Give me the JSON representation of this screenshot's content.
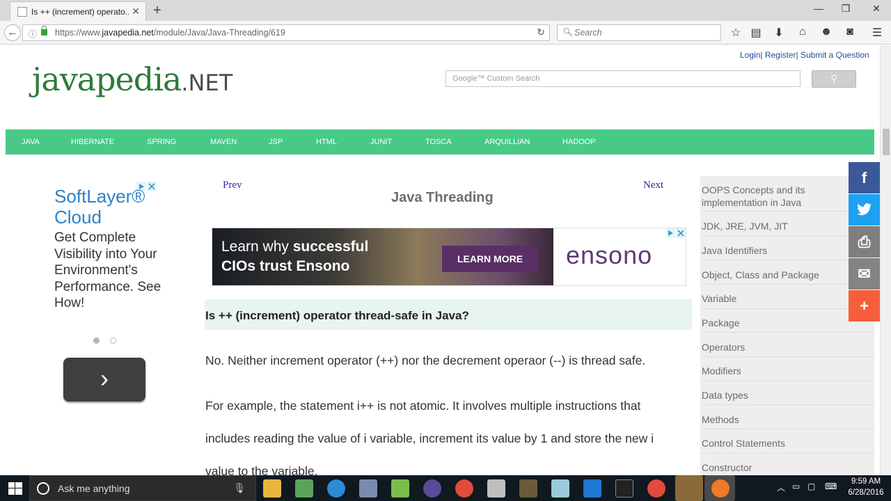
{
  "browser": {
    "tab_title": "Is ++ (increment) operato...",
    "url_prefix": "https://www.",
    "url_host": "javapedia.net",
    "url_path": "/module/Java/Java-Threading/619",
    "search_placeholder": "Search"
  },
  "header": {
    "top_links": [
      "Login",
      "Register",
      "Submit a Question"
    ],
    "logo_main": "javapedia",
    "logo_suffix": ".NET",
    "google_search_label": "Google™ Custom Search"
  },
  "nav": {
    "items": [
      "JAVA",
      "HIBERNATE",
      "SPRING",
      "MAVEN",
      "JSP",
      "HTML",
      "JUNIT",
      "TOSCA",
      "ARQUILLIAN",
      "HADOOP"
    ]
  },
  "ad_left": {
    "title": "SoftLayer® Cloud",
    "body": "Get Complete Visibility into Your Environment's Performance. See How!"
  },
  "article": {
    "prev": "Prev",
    "next": "Next",
    "title": "Java Threading",
    "banner_line1_a": "Learn why ",
    "banner_line1_b": "successful",
    "banner_line2": "CIOs trust Ensono",
    "banner_button": "LEARN MORE",
    "banner_brand": "ensono",
    "question": "Is ++ (increment) operator thread-safe in Java?",
    "answer": "No. Neither increment operator (++) nor the decrement operaor (--) is thread safe.",
    "para_lines": [
      "For example, the statement i++ is not atomic. It involves multiple instructions that",
      "includes reading the value of i variable, increment its value by 1 and store the new i",
      "value to the variable."
    ]
  },
  "sidebar": {
    "items": [
      "OOPS Concepts and its implementation in Java",
      "JDK, JRE, JVM, JIT",
      "Java Identifiers",
      "Object, Class and Package",
      "Variable",
      "Package",
      "Operators",
      "Modifiers",
      "Data types",
      "Methods",
      "Control Statements",
      "Constructor"
    ]
  },
  "taskbar": {
    "cortana_placeholder": "Ask me anything",
    "time": "9:59 AM",
    "date": "6/28/2016"
  }
}
